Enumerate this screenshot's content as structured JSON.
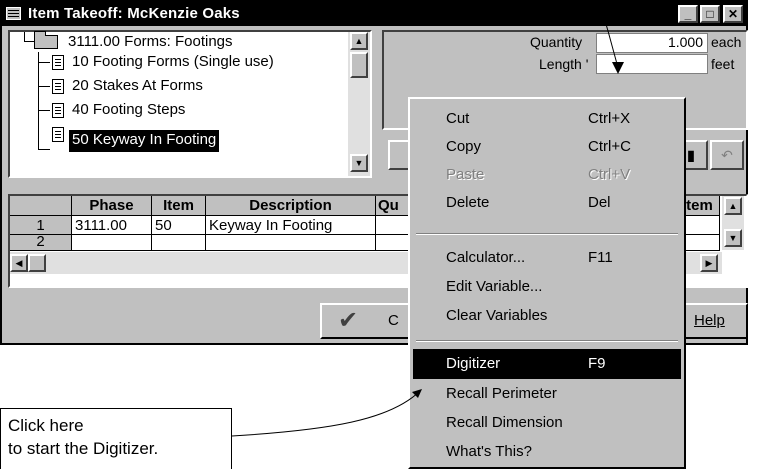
{
  "window": {
    "title": "Item Takeoff: McKenzie Oaks",
    "minimize_glyph": "_",
    "maximize_glyph": "□",
    "close_glyph": "✕"
  },
  "tree": {
    "parent_label": "3111.00 Forms: Footings",
    "items": [
      {
        "label": "10 Footing Forms (Single use)",
        "selected": false
      },
      {
        "label": "20 Stakes At Forms",
        "selected": false
      },
      {
        "label": "40 Footing Steps",
        "selected": false
      },
      {
        "label": "50 Keyway In Footing",
        "selected": true
      }
    ]
  },
  "quantity_panel": {
    "quantity_label": "Quantity",
    "quantity_value": "1.000",
    "quantity_unit": "each",
    "length_label": "Length '",
    "length_value": "",
    "length_unit": "feet",
    "undo_glyph": "↶"
  },
  "grid": {
    "columns": [
      "Phase",
      "Item",
      "Description",
      "Qu",
      "tem"
    ],
    "rows": [
      {
        "num": "1",
        "phase": "3111.00",
        "item": "50",
        "description": "Keyway In Footing"
      },
      {
        "num": "2",
        "phase": "",
        "item": "",
        "description": ""
      }
    ]
  },
  "buttons": {
    "ok_label": "C",
    "ok_check": "✔",
    "help_label": "Help"
  },
  "context_menu": {
    "items": [
      {
        "label": "Cut",
        "shortcut": "Ctrl+X",
        "state": "normal"
      },
      {
        "label": "Copy",
        "shortcut": "Ctrl+C",
        "state": "normal"
      },
      {
        "label": "Paste",
        "shortcut": "Ctrl+V",
        "state": "disabled"
      },
      {
        "label": "Delete",
        "shortcut": "Del",
        "state": "normal"
      },
      {
        "label": "Calculator...",
        "shortcut": "F11",
        "state": "normal"
      },
      {
        "label": "Edit Variable...",
        "shortcut": "",
        "state": "normal"
      },
      {
        "label": "Clear Variables",
        "shortcut": "",
        "state": "normal"
      },
      {
        "label": "Digitizer",
        "shortcut": "F9",
        "state": "highlighted"
      },
      {
        "label": "Recall Perimeter",
        "shortcut": "",
        "state": "normal"
      },
      {
        "label": "Recall Dimension",
        "shortcut": "",
        "state": "normal"
      },
      {
        "label": "What's This?",
        "shortcut": "",
        "state": "normal"
      }
    ]
  },
  "callout": {
    "line1": "Click here",
    "line2": "to start the Digitizer."
  }
}
